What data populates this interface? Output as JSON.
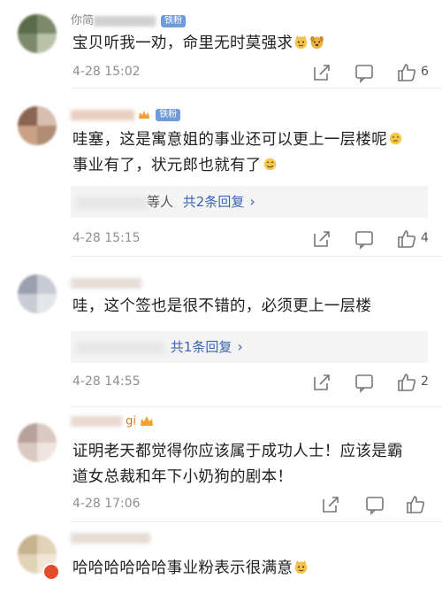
{
  "comments": [
    {
      "username": "你简",
      "badge": "铁粉",
      "text": "宝贝听我一劝，命里无时莫强求",
      "time": "4-28 15:02",
      "likes": "6",
      "reply_summary": ""
    },
    {
      "username": "",
      "badge": "铁粉",
      "text": "哇塞，这是寓意姐的事业还可以更上一层楼呢事业有了，状元郎也就有了",
      "line1": "哇塞，这是寓意姐的事业还可以更上一层楼呢",
      "line2": "事业有了，状元郎也就有了",
      "time": "4-28 15:15",
      "likes": "4",
      "reply_prefix": "等人",
      "reply_summary": "共2条回复"
    },
    {
      "username": "",
      "badge": "",
      "text": "哇，这个签也是很不错的，必须更上一层楼",
      "time": "4-28 14:55",
      "likes": "2",
      "reply_prefix": "",
      "reply_summary": "共1条回复"
    },
    {
      "username": "gi",
      "badge": "",
      "line1": "证明老天都觉得你应该属于成功人士！应该是霸",
      "line2": "道女总裁和年下小奶狗的剧本！",
      "time": "4-28 17:06",
      "likes": ""
    },
    {
      "username": "",
      "badge": "",
      "text": "哈哈哈哈哈哈事业粉表示很满意"
    }
  ],
  "icons": {
    "share": "share-icon",
    "comment": "comment-icon",
    "like": "thumbs-up-icon",
    "chevron": "chevron-right-icon"
  },
  "colors": {
    "link": "#3a64b6",
    "badge": "#6f9cd8",
    "meta": "#8e8e8e"
  }
}
